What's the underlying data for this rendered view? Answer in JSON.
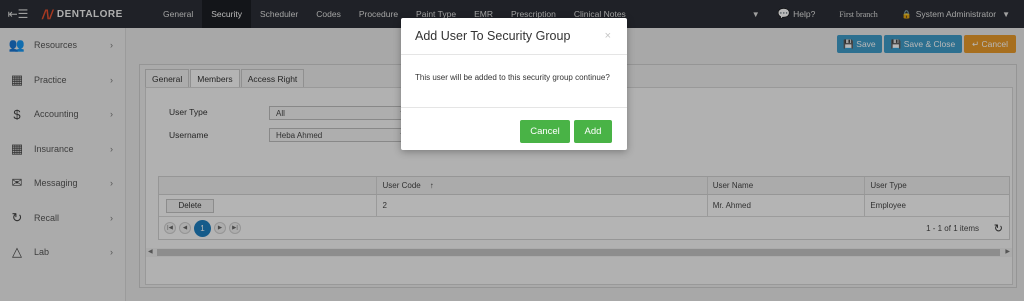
{
  "topbar": {
    "brand": "DENTALORE",
    "nav": [
      "General",
      "Security",
      "Scheduler",
      "Codes",
      "Procedure",
      "Paint Type",
      "EMR",
      "Prescription",
      "Clinical Notes"
    ],
    "active_nav": "Security",
    "help": "Help?",
    "branch": "First branch",
    "user": "System Administrator"
  },
  "sidebar": {
    "items": [
      {
        "label": "Resources",
        "icon": "users-icon"
      },
      {
        "label": "Practice",
        "icon": "medical-kit-icon"
      },
      {
        "label": "Accounting",
        "icon": "dollar-icon"
      },
      {
        "label": "Insurance",
        "icon": "building-icon"
      },
      {
        "label": "Messaging",
        "icon": "envelope-icon"
      },
      {
        "label": "Recall",
        "icon": "refresh-icon"
      },
      {
        "label": "Lab",
        "icon": "flask-icon"
      }
    ]
  },
  "toolbar": {
    "save": "Save",
    "save_close": "Save & Close",
    "cancel": "Cancel"
  },
  "tabs": [
    "General",
    "Members",
    "Access Right"
  ],
  "form": {
    "user_type_label": "User Type",
    "user_type_value": "All",
    "username_label": "Username",
    "username_value": "Heba Ahmed"
  },
  "grid": {
    "headers": [
      "",
      "User Code",
      "User Name",
      "User Type"
    ],
    "rows": [
      {
        "action": "Delete",
        "code": "2",
        "name": "Mr. Ahmed",
        "type": "Employee"
      }
    ],
    "current_page": "1",
    "info": "1 - 1 of 1 items"
  },
  "modal": {
    "title": "Add User To Security Group",
    "close": "×",
    "body": "This user will be added to this security group continue?",
    "cancel": "Cancel",
    "add": "Add"
  },
  "colors": {
    "topbar": "#2b2f36",
    "primary_button": "#3f9bc8",
    "cancel_button": "#e89a2b",
    "modal_button": "#49b346",
    "brand_accent": "#e8502f"
  }
}
